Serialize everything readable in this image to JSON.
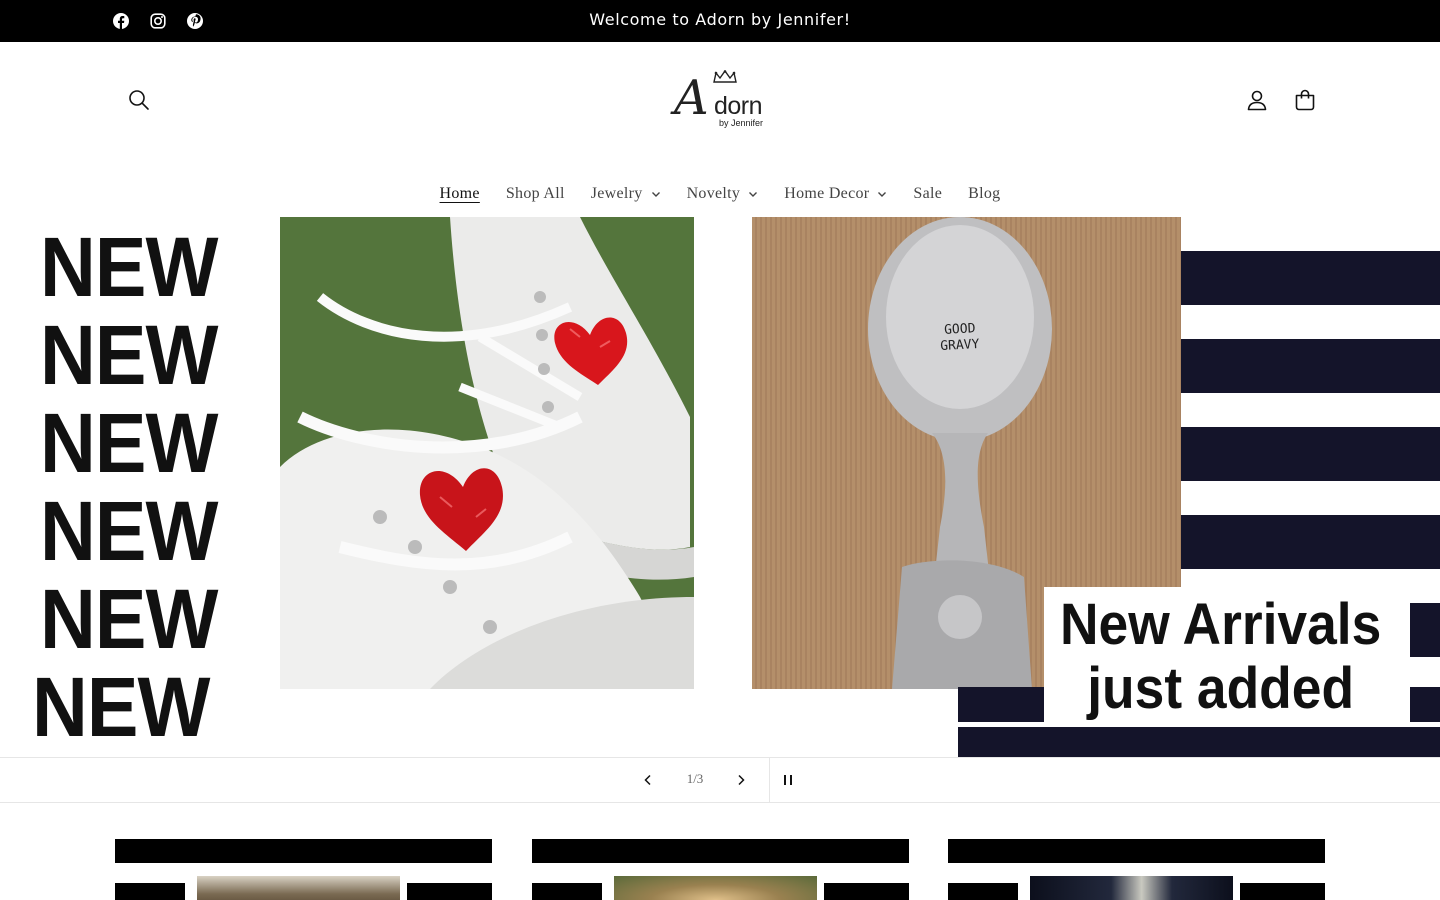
{
  "announcement": {
    "message": "Welcome to Adorn by Jennifer!",
    "social": [
      "facebook-icon",
      "instagram-icon",
      "pinterest-icon"
    ]
  },
  "header": {
    "logo": {
      "letter": "A",
      "name": "dorn",
      "tagline": "by Jennifer"
    },
    "icons": [
      "search-icon",
      "account-icon",
      "cart-icon"
    ]
  },
  "nav": {
    "items": [
      {
        "label": "Home",
        "active": true,
        "dropdown": false
      },
      {
        "label": "Shop All",
        "active": false,
        "dropdown": false
      },
      {
        "label": "Jewelry",
        "active": false,
        "dropdown": true
      },
      {
        "label": "Novelty",
        "active": false,
        "dropdown": true
      },
      {
        "label": "Home Decor",
        "active": false,
        "dropdown": true
      },
      {
        "label": "Sale",
        "active": false,
        "dropdown": false
      },
      {
        "label": "Blog",
        "active": false,
        "dropdown": false
      }
    ]
  },
  "hero": {
    "new_words": [
      "NEW",
      "NEW",
      "NEW",
      "NEW",
      "NEW",
      "NEW"
    ],
    "spoon_text": "GOOD GRAVY",
    "headline_line1": "New Arrivals",
    "headline_line2": "just added"
  },
  "slider": {
    "counter": "1/3",
    "current": 1,
    "total": 3
  },
  "colors": {
    "announcement_bg": "#000000",
    "stripe_navy": "#14142a",
    "heart_red": "#d8161c"
  }
}
